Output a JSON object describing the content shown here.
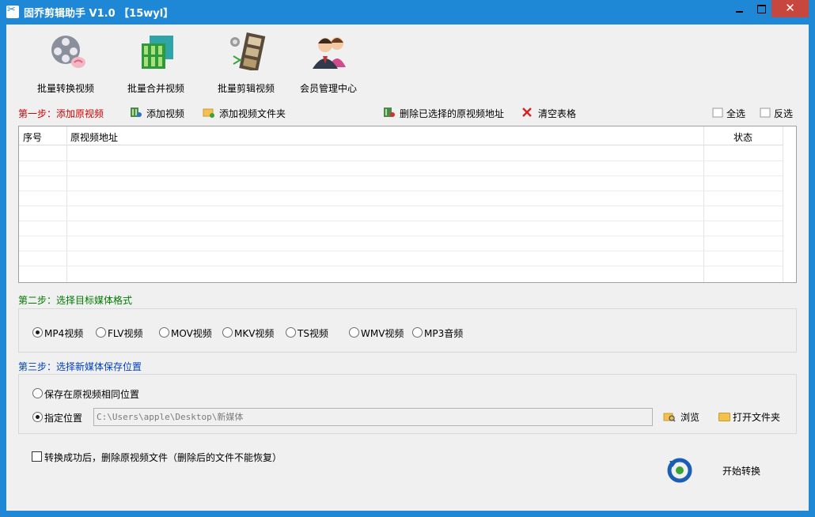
{
  "window": {
    "title": "固乔剪辑助手 V1.0  【15wyl】",
    "close_glyph": "✕"
  },
  "toolbar": [
    {
      "label": "批量转换视频",
      "icon": "film-reel-icon"
    },
    {
      "label": "批量合并视频",
      "icon": "film-merge-icon"
    },
    {
      "label": "批量剪辑视频",
      "icon": "film-cut-icon"
    },
    {
      "label": "会员管理中心",
      "icon": "members-icon"
    }
  ],
  "step1": {
    "label": "第一步：添加原视频",
    "actions": {
      "add_video": "添加视频",
      "add_folder": "添加视频文件夹",
      "delete_selected": "删除已选择的原视频地址",
      "clear_table": "清空表格",
      "select_all": "全选",
      "invert_selection": "反选"
    },
    "table": {
      "columns": [
        "序号",
        "原视频地址",
        "状态"
      ],
      "rows": []
    }
  },
  "step2": {
    "label": "第二步：选择目标媒体格式",
    "formats": [
      {
        "label": "MP4视频",
        "selected": true
      },
      {
        "label": "FLV视频",
        "selected": false
      },
      {
        "label": "MOV视频",
        "selected": false
      },
      {
        "label": "MKV视频",
        "selected": false
      },
      {
        "label": "TS视频",
        "selected": false
      },
      {
        "label": "WMV视频",
        "selected": false
      },
      {
        "label": "MP3音频",
        "selected": false
      }
    ]
  },
  "step3": {
    "label": "第三步：选择新媒体保存位置",
    "same_location": {
      "label": "保存在原视频相同位置",
      "selected": false
    },
    "custom_location": {
      "label": "指定位置",
      "selected": true
    },
    "path": "C:\\Users\\apple\\Desktop\\新媒体",
    "browse": "浏览",
    "open_folder": "打开文件夹"
  },
  "delete_after": {
    "label": "转换成功后，删除原视频文件（删除后的文件不能恢复）",
    "checked": false
  },
  "start_label": "开始转换",
  "colors": {
    "titlebar": "#1e88d6",
    "close": "#c7463d",
    "step1": "#d40000",
    "step2": "#007a00",
    "step3": "#0040c0"
  }
}
